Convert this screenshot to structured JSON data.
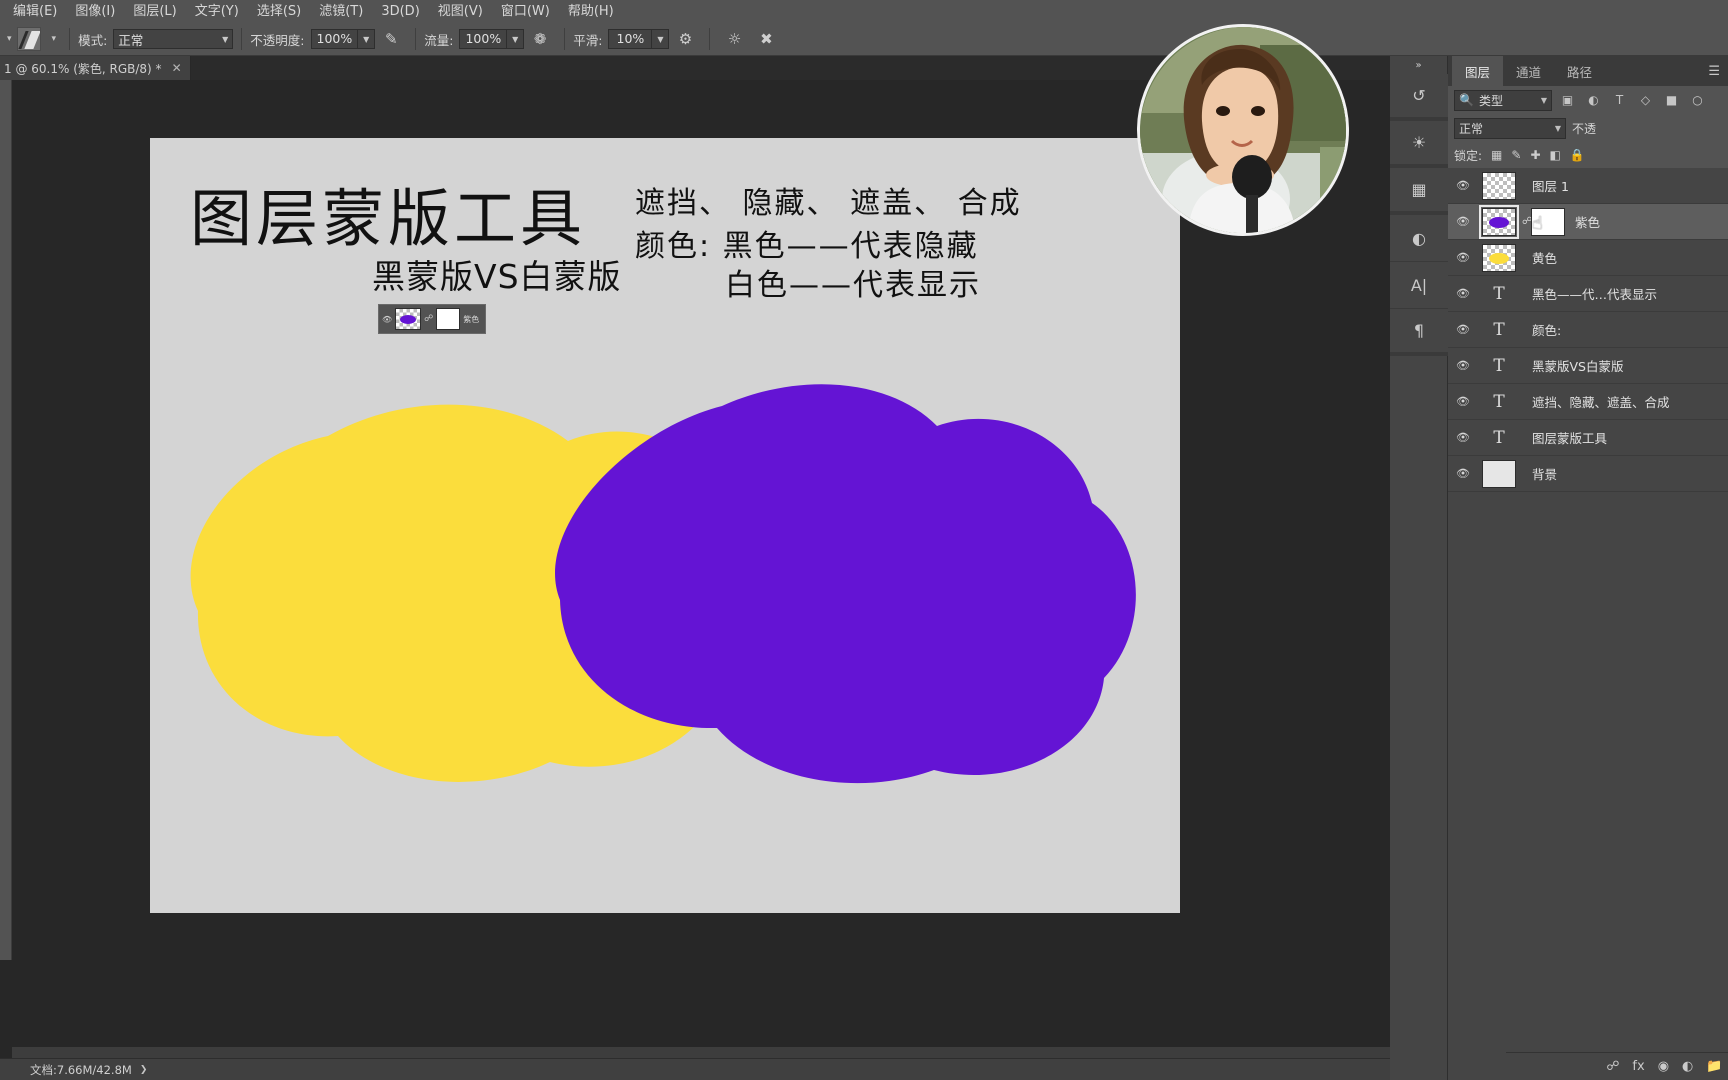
{
  "menu": {
    "items": [
      {
        "label": "编辑(E)"
      },
      {
        "label": "图像(I)"
      },
      {
        "label": "图层(L)"
      },
      {
        "label": "文字(Y)"
      },
      {
        "label": "选择(S)"
      },
      {
        "label": "滤镜(T)"
      },
      {
        "label": "3D(D)"
      },
      {
        "label": "视图(V)"
      },
      {
        "label": "窗口(W)"
      },
      {
        "label": "帮助(H)"
      }
    ]
  },
  "options_bar": {
    "tool_icon": "brush-tool-icon",
    "mode_label": "模式:",
    "mode_value": "正常",
    "opacity_label": "不透明度:",
    "opacity_value": "100%",
    "pressure_opacity_icon": "pressure-opacity-icon",
    "flow_label": "流量:",
    "flow_value": "100%",
    "airbrush_icon": "airbrush-icon",
    "smoothing_label": "平滑:",
    "smoothing_value": "10%",
    "gear_icon": "gear-icon",
    "symmetry_icon": "symmetry-icon",
    "tablet_pressure_icon": "tablet-pressure-icon"
  },
  "document_tab": {
    "title": "1 @ 60.1% (紫色, RGB/8) *",
    "close_icon": "close-icon"
  },
  "artwork": {
    "title": "图层蒙版工具",
    "subtitle": "黑蒙版VS白蒙版",
    "line1": "遮挡、 隐藏、 遮盖、 合成",
    "line2": "颜色: 黑色——代表隐藏",
    "line3": "白色——代表显示",
    "mini_panel": {
      "eye_icon": "eye-icon",
      "layer_thumb": "purple-blob-thumbnail",
      "link_icon": "link-icon",
      "mask_thumb": "white-mask-thumbnail",
      "name": "紫色"
    },
    "colors": {
      "background": "#d4d4d4",
      "yellow_blob": "#fbdd3c",
      "purple_blob": "#6414d4"
    }
  },
  "webcam": {
    "label": "streamer-webcam-overlay"
  },
  "right_dock": {
    "collapse_icon": "double-chevron-right-icon",
    "rail_buttons": [
      {
        "name": "history-panel-icon"
      },
      {
        "name": "swatches-panel-icon"
      },
      {
        "name": "properties-grid-icon"
      },
      {
        "name": "adjustments-panel-icon"
      },
      {
        "name": "character-panel-icon"
      },
      {
        "name": "paragraph-panel-icon"
      }
    ],
    "panel_tabs": [
      {
        "label": "图层",
        "active": true
      },
      {
        "label": "通道",
        "active": false
      },
      {
        "label": "路径",
        "active": false
      }
    ],
    "panel_menu_icon": "panel-menu-icon",
    "filter": {
      "search_icon": "search-icon",
      "type_value": "类型",
      "chevron": "chevron-down-icon",
      "icons": [
        {
          "name": "filter-pixel-icon"
        },
        {
          "name": "filter-adjustment-icon"
        },
        {
          "name": "filter-type-icon"
        },
        {
          "name": "filter-shape-icon"
        },
        {
          "name": "filter-smart-object-icon"
        },
        {
          "name": "filter-toggle-icon"
        }
      ]
    },
    "blend": {
      "mode_value": "正常",
      "opacity_label": "不透"
    },
    "lock": {
      "label": "锁定:",
      "icons": [
        {
          "name": "lock-transparency-icon"
        },
        {
          "name": "lock-image-icon"
        },
        {
          "name": "lock-position-icon"
        },
        {
          "name": "lock-nesting-icon"
        },
        {
          "name": "lock-all-icon"
        }
      ]
    },
    "layers": [
      {
        "name": "图层 1",
        "kind": "pixel",
        "thumb": "transparent",
        "selected": false,
        "visible": true
      },
      {
        "name": "紫色",
        "kind": "pixel-with-mask",
        "thumb": "purple-blob",
        "selected": true,
        "visible": true
      },
      {
        "name": "黄色",
        "kind": "pixel",
        "thumb": "yellow-blob",
        "selected": false,
        "visible": true
      },
      {
        "name": "黑色——代…代表显示",
        "kind": "text",
        "selected": false,
        "visible": true
      },
      {
        "name": "颜色:",
        "kind": "text",
        "selected": false,
        "visible": true
      },
      {
        "name": "黑蒙版VS白蒙版",
        "kind": "text",
        "selected": false,
        "visible": true
      },
      {
        "name": "遮挡、隐藏、遮盖、合成",
        "kind": "text",
        "selected": false,
        "visible": true
      },
      {
        "name": "图层蒙版工具",
        "kind": "text",
        "selected": false,
        "visible": true
      },
      {
        "name": "背景",
        "kind": "background",
        "thumb": "white",
        "selected": false,
        "visible": true
      }
    ],
    "bottom_buttons": [
      {
        "name": "link-layers-icon"
      },
      {
        "name": "layer-style-fx-icon"
      },
      {
        "name": "add-mask-icon"
      },
      {
        "name": "adjustment-layer-icon"
      },
      {
        "name": "new-group-icon"
      },
      {
        "name": "new-layer-icon"
      },
      {
        "name": "delete-layer-icon"
      }
    ]
  },
  "status_bar": {
    "doc_info": "文档:7.66M/42.8M",
    "arrow_icon": "chevron-right-icon"
  }
}
